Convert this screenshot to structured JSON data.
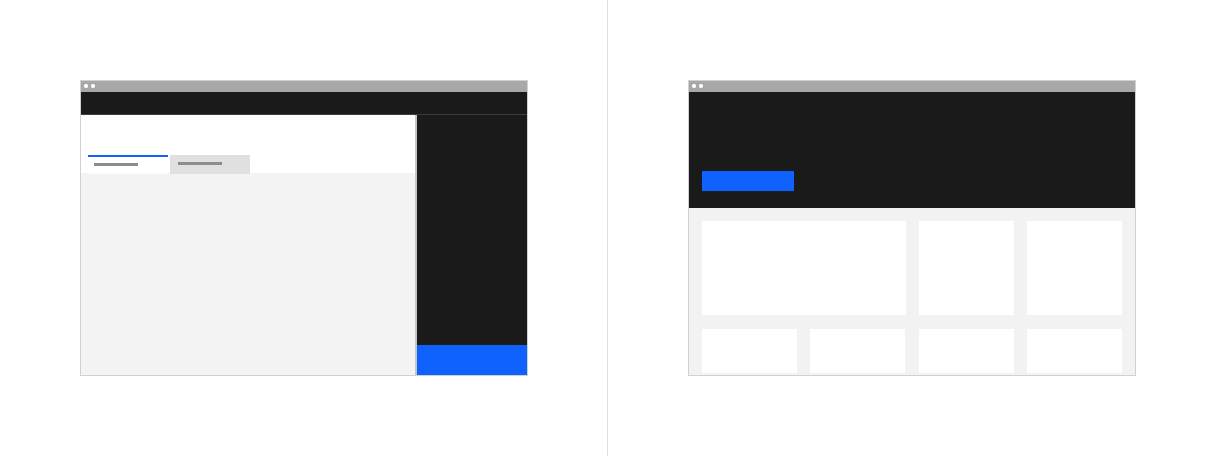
{
  "colors": {
    "page_background": "#ffffff",
    "chrome_bar": "#a8a8a8",
    "dark_ui": "#1a1a1a",
    "accent_blue": "#0f62fe",
    "surface_light": "#f3f3f3",
    "tab_inactive": "#e0e0e0",
    "placeholder_text": "#8d8d8d"
  },
  "left_mockup": {
    "kind": "wireframe-page-with-right-side-panel",
    "tabs": [
      {
        "state": "selected",
        "label_placeholder": "gray-bar"
      },
      {
        "state": "unselected",
        "label_placeholder": "gray-bar"
      }
    ],
    "side_panel": {
      "theme": "dark",
      "footer_button_color": "#0f62fe"
    }
  },
  "right_mockup": {
    "kind": "wireframe-landing-page",
    "hero": {
      "theme": "dark",
      "cta_color": "#0f62fe"
    },
    "card_rows": [
      {
        "cards": [
          "wide",
          "square",
          "square"
        ]
      },
      {
        "cards": [
          "short",
          "short",
          "short",
          "short"
        ]
      }
    ]
  }
}
